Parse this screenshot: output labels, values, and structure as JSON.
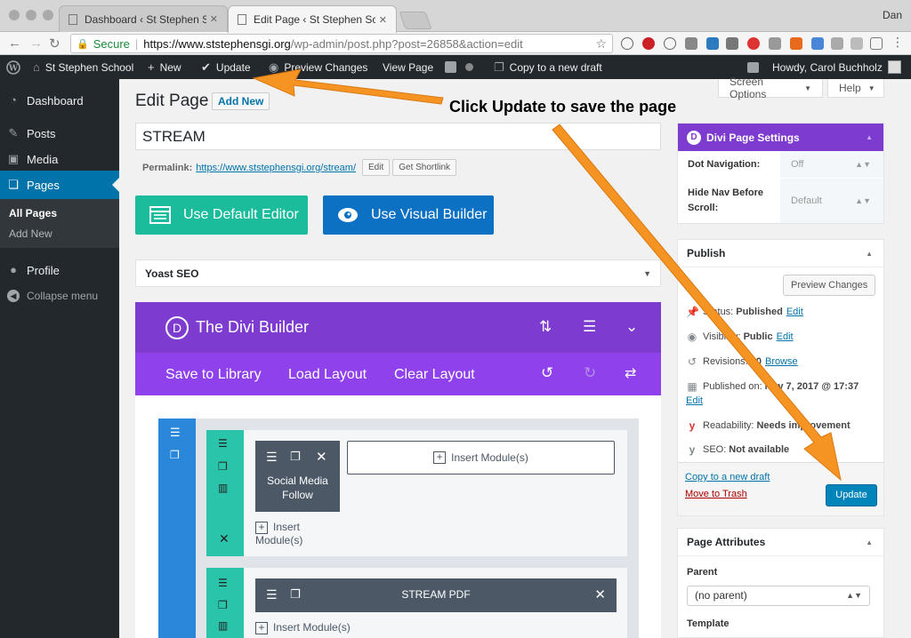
{
  "browser": {
    "tabs": [
      {
        "title": "Dashboard ‹ St Stephen School"
      },
      {
        "title": "Edit Page ‹ St Stephen School"
      }
    ],
    "user": "Dan",
    "secure_label": "Secure",
    "url_host": "https://www.ststephensgi.org",
    "url_path": "/wp-admin/post.php?post=26858&action=edit"
  },
  "adminbar": {
    "site": "St Stephen School",
    "new": "New",
    "update": "Update",
    "preview": "Preview Changes",
    "view": "View Page",
    "copy": "Copy to a new draft",
    "howdy": "Howdy, Carol Buchholz"
  },
  "sidebar": {
    "items": [
      {
        "label": "Dashboard"
      },
      {
        "label": "Posts"
      },
      {
        "label": "Media"
      },
      {
        "label": "Pages"
      }
    ],
    "submenu": [
      {
        "label": "All Pages"
      },
      {
        "label": "Add New"
      }
    ],
    "profile": "Profile",
    "collapse": "Collapse menu"
  },
  "editor": {
    "heading": "Edit Page",
    "add_new": "Add New",
    "title_value": "STREAM",
    "permalink_label": "Permalink:",
    "permalink_url": "https://www.ststephensgi.org/stream/",
    "edit_btn": "Edit",
    "shortlink_btn": "Get Shortlink",
    "default_editor": "Use Default Editor",
    "visual_builder": "Use Visual Builder",
    "yoast": "Yoast SEO"
  },
  "divi": {
    "logo": "D",
    "title": "The Divi Builder",
    "save_library": "Save to Library",
    "load_layout": "Load Layout",
    "clear_layout": "Clear Layout",
    "insert_modules": "Insert Module(s)",
    "insert_line1": "Insert",
    "insert_line2": "Module(s)",
    "module1_line1": "Social Media",
    "module1_line2": "Follow",
    "module2": "STREAM PDF"
  },
  "screen_options": {
    "screen": "Screen Options",
    "help": "Help"
  },
  "divi_settings": {
    "title": "Divi Page Settings",
    "dot_nav_label": "Dot Navigation:",
    "dot_nav_value": "Off",
    "hide_nav_label_1": "Hide Nav Before",
    "hide_nav_label_2": "Scroll:",
    "hide_nav_value": "Default"
  },
  "publish": {
    "title": "Publish",
    "preview_btn": "Preview Changes",
    "status_label": "Status:",
    "status_value": "Published",
    "visibility_label": "Visibility:",
    "visibility_value": "Public",
    "revisions_label": "Revisions:",
    "revisions_value": "10",
    "browse": "Browse",
    "published_label": "Published on:",
    "published_value": "Nov 7, 2017 @ 17:37",
    "readability_label": "Readability:",
    "readability_value": "Needs improvement",
    "seo_label": "SEO:",
    "seo_value": "Not available",
    "edit": "Edit",
    "copy_draft": "Copy to a new draft",
    "trash": "Move to Trash",
    "update": "Update"
  },
  "page_attributes": {
    "title": "Page Attributes",
    "parent_label": "Parent",
    "parent_value": "(no parent)",
    "template_label": "Template"
  },
  "annotation": {
    "text": "Click Update to save the page"
  },
  "colors": {
    "admin_dark": "#23282d",
    "wp_blue": "#0073aa",
    "divi_purple": "#7e3bd0",
    "divi_purple_light": "#8f42ec",
    "teal": "#1bbc9b",
    "builder_blue": "#0c71c3",
    "row_green": "#29c4a9",
    "section_blue": "#2b87da",
    "module_dark": "#4c5866",
    "arrow_orange": "#f59323"
  }
}
